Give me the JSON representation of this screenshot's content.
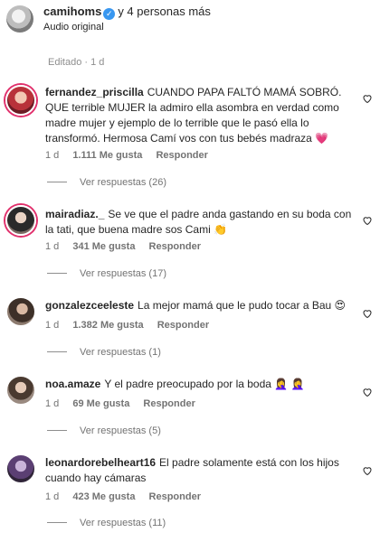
{
  "header": {
    "author": "camihoms",
    "others": "y 4 personas más",
    "audio": "Audio original"
  },
  "post": {
    "edited": "Editado · 1 d"
  },
  "comments": [
    {
      "user": "fernandez_priscilla",
      "text": "CUANDO PAPA FALTÓ MAMÁ SOBRÓ. QUE terrible MUJER la admiro ella asombra en verdad como madre mujer y ejemplo de lo terrible que le pasó ella lo transformó. Hermosa Camí vos con tus bebés madraza 💗",
      "time": "1 d",
      "likes": "1.111 Me gusta",
      "reply": "Responder",
      "view_replies": "Ver respuestas (26)"
    },
    {
      "user": "mairadiaz._",
      "text": "Se ve que el padre anda gastando en su boda con la tati, que buena madre sos Cami 👏",
      "time": "1 d",
      "likes": "341 Me gusta",
      "reply": "Responder",
      "view_replies": "Ver respuestas (17)"
    },
    {
      "user": "gonzalezceeleste",
      "text": "La mejor mamá que le pudo tocar a Bau 😍",
      "time": "1 d",
      "likes": "1.382 Me gusta",
      "reply": "Responder",
      "view_replies": "Ver respuestas (1)"
    },
    {
      "user": "noa.amaze",
      "text": "Y el padre preocupado por la boda 🤦‍♀️ 🤦‍♀️",
      "time": "1 d",
      "likes": "69 Me gusta",
      "reply": "Responder",
      "view_replies": "Ver respuestas (5)"
    },
    {
      "user": "leonardorebelheart16",
      "text": "El padre solamente está con los hijos cuando hay cámaras",
      "time": "1 d",
      "likes": "423 Me gusta",
      "reply": "Responder",
      "view_replies": "Ver respuestas (11)"
    }
  ],
  "colors": {
    "verified": "#3897f0",
    "story_ring": "#e1306c",
    "muted_text": "#737373"
  },
  "icons": {
    "like": "heart-outline-icon",
    "verified": "verified-badge-icon"
  }
}
